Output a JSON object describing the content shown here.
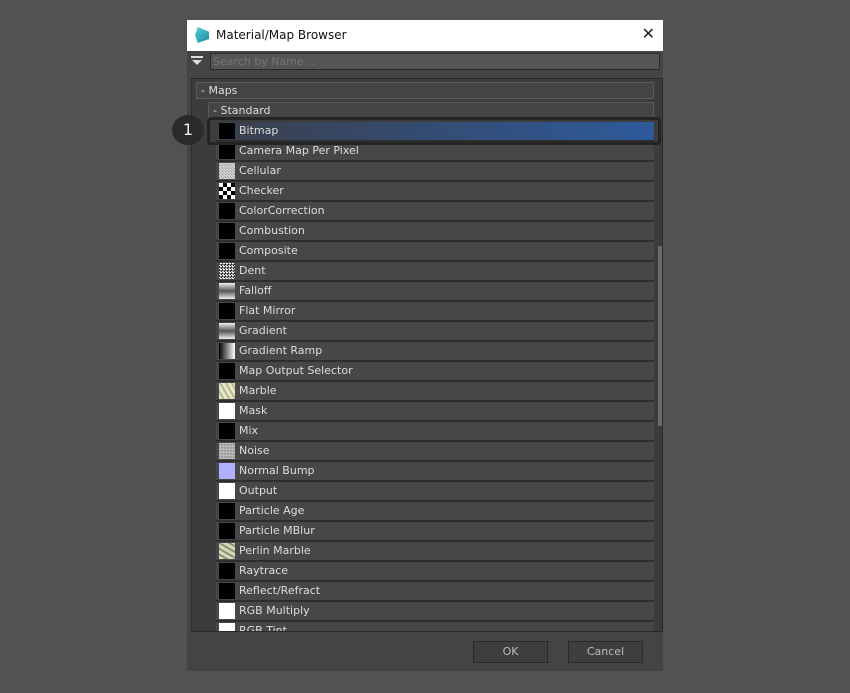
{
  "window": {
    "title": "Material/Map Browser"
  },
  "search": {
    "placeholder": "Search by Name ..."
  },
  "tree": {
    "root": "- Maps",
    "group": "- Standard"
  },
  "items": [
    {
      "label": "Bitmap",
      "swatch": "black",
      "selected": true
    },
    {
      "label": "Camera Map Per Pixel",
      "swatch": "black"
    },
    {
      "label": "Cellular",
      "swatch": "noise-light"
    },
    {
      "label": "Checker",
      "swatch": "checker"
    },
    {
      "label": "ColorCorrection",
      "swatch": "black"
    },
    {
      "label": "Combustion",
      "swatch": "black"
    },
    {
      "label": "Composite",
      "swatch": "black"
    },
    {
      "label": "Dent",
      "swatch": "noise-dark"
    },
    {
      "label": "Falloff",
      "swatch": "gradient-v"
    },
    {
      "label": "Flat Mirror",
      "swatch": "black"
    },
    {
      "label": "Gradient",
      "swatch": "gradient-v"
    },
    {
      "label": "Gradient Ramp",
      "swatch": "gradient-h"
    },
    {
      "label": "Map Output Selector",
      "swatch": "black"
    },
    {
      "label": "Marble",
      "swatch": "marble"
    },
    {
      "label": "Mask",
      "swatch": "white"
    },
    {
      "label": "Mix",
      "swatch": "black"
    },
    {
      "label": "Noise",
      "swatch": "noise-gray"
    },
    {
      "label": "Normal Bump",
      "swatch": "lavender"
    },
    {
      "label": "Output",
      "swatch": "white"
    },
    {
      "label": "Particle Age",
      "swatch": "black"
    },
    {
      "label": "Particle MBlur",
      "swatch": "black"
    },
    {
      "label": "Perlin Marble",
      "swatch": "perlin"
    },
    {
      "label": "Raytrace",
      "swatch": "black"
    },
    {
      "label": "Reflect/Refract",
      "swatch": "black"
    },
    {
      "label": "RGB Multiply",
      "swatch": "white"
    },
    {
      "label": "RGB Tint",
      "swatch": "white"
    }
  ],
  "callout": "1",
  "buttons": {
    "ok": "OK",
    "cancel": "Cancel"
  },
  "colors": {
    "selection": "#2e5a9c",
    "normal_bump": "#b0b0ff"
  }
}
